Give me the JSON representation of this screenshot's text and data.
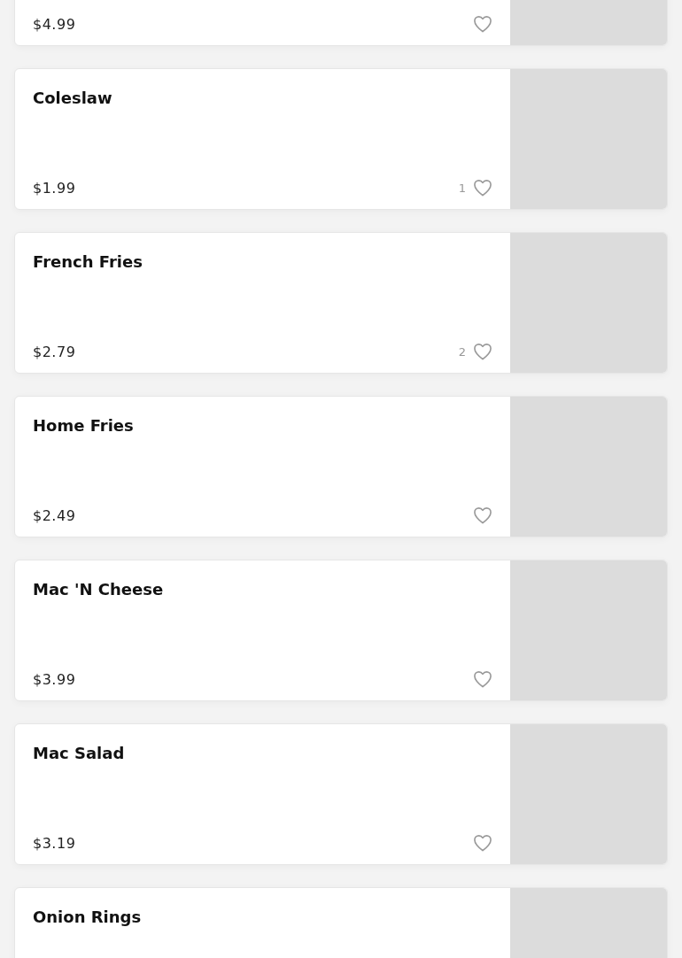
{
  "items": [
    {
      "price": "$4.99"
    },
    {
      "name": "Coleslaw",
      "price": "$1.99",
      "likes": "1"
    },
    {
      "name": "French Fries",
      "price": "$2.79",
      "likes": "2"
    },
    {
      "name": "Home Fries",
      "price": "$2.49"
    },
    {
      "name": "Mac 'N Cheese",
      "price": "$3.99"
    },
    {
      "name": "Mac Salad",
      "price": "$3.19"
    },
    {
      "name": "Onion Rings"
    }
  ]
}
